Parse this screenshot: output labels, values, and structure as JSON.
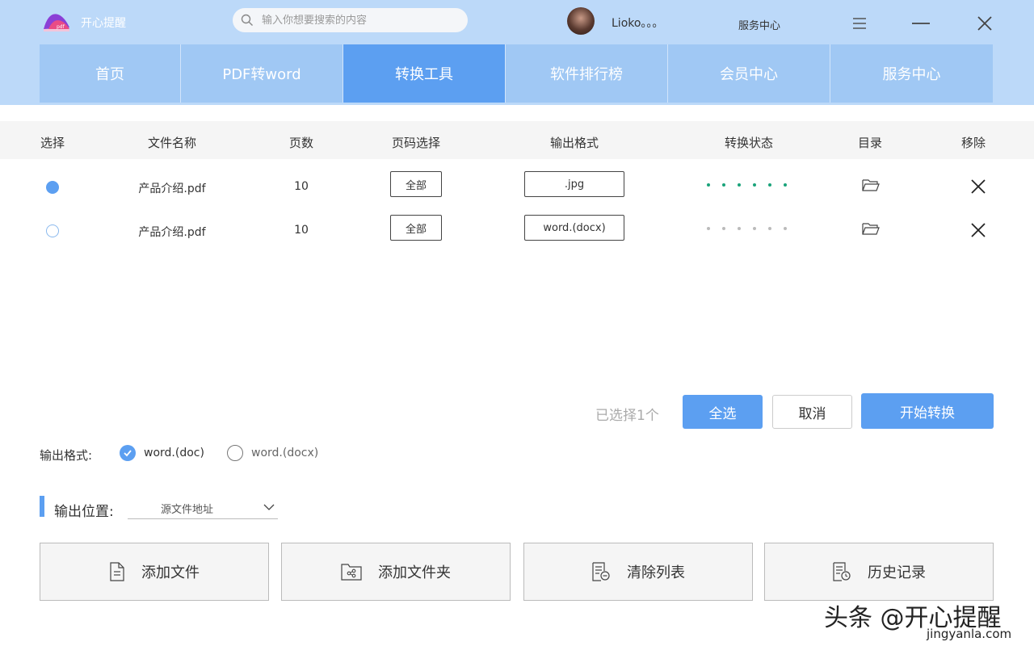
{
  "header": {
    "app_name": "开心提醒",
    "search_placeholder": "输入你想要搜索的内容",
    "username": "Lioko。。。",
    "service_link": "服务中心"
  },
  "nav": {
    "tabs": [
      {
        "label": "首页",
        "active": false
      },
      {
        "label": "PDF转word",
        "active": false
      },
      {
        "label": "转换工具",
        "active": true
      },
      {
        "label": "软件排行榜",
        "active": false
      },
      {
        "label": "会员中心",
        "active": false
      },
      {
        "label": "服务中心",
        "active": false
      }
    ]
  },
  "table": {
    "headers": {
      "select": "选择",
      "filename": "文件名称",
      "pages": "页数",
      "page_select": "页码选择",
      "format": "输出格式",
      "status": "转换状态",
      "directory": "目录",
      "remove": "移除"
    },
    "rows": [
      {
        "selected": true,
        "filename": "产品介绍.pdf",
        "pages": "10",
        "page_select": "全部",
        "format": ".jpg",
        "status_color": "#1aa37a"
      },
      {
        "selected": false,
        "filename": "产品介绍.pdf",
        "pages": "10",
        "page_select": "全部",
        "format": "word.(docx)",
        "status_color": "#bbbbbb"
      }
    ]
  },
  "actions_bar": {
    "selected_info": "已选择1个",
    "select_all": "全选",
    "cancel": "取消",
    "start": "开始转换"
  },
  "output_format": {
    "label": "输出格式:",
    "options": [
      {
        "label": "word.(doc)",
        "checked": true
      },
      {
        "label": "word.(docx)",
        "checked": false
      }
    ]
  },
  "output_location": {
    "label": "输出位置:",
    "value": "源文件地址"
  },
  "bottom_actions": {
    "add_file": "添加文件",
    "add_folder": "添加文件夹",
    "clear_list": "清除列表",
    "history": "历史记录"
  },
  "watermark": {
    "text": "头条 @开心提醒",
    "url": "jingyanla.com"
  },
  "colors": {
    "accent": "#5c9ff1",
    "header_bg": "#bcd9f9",
    "tab_bg": "#a0c8f4",
    "progress_done": "#1aa37a"
  }
}
